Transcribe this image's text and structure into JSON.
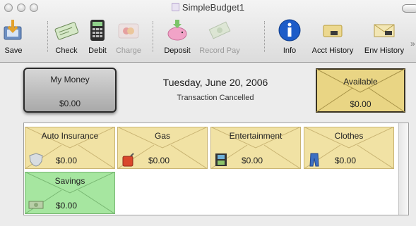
{
  "window": {
    "title": "SimpleBudget1"
  },
  "toolbar": [
    {
      "label": "Save",
      "icon": "save-icon",
      "enabled": true
    },
    {
      "label": "Check",
      "icon": "check-icon",
      "enabled": true
    },
    {
      "label": "Debit",
      "icon": "debit-icon",
      "enabled": true
    },
    {
      "label": "Charge",
      "icon": "charge-icon",
      "enabled": false
    },
    {
      "label": "Deposit",
      "icon": "deposit-icon",
      "enabled": true
    },
    {
      "label": "Record Pay",
      "icon": "record-pay-icon",
      "enabled": false
    },
    {
      "label": "Info",
      "icon": "info-icon",
      "enabled": true
    },
    {
      "label": "Acct History",
      "icon": "acct-history-icon",
      "enabled": true
    },
    {
      "label": "Env History",
      "icon": "env-history-icon",
      "enabled": true
    }
  ],
  "overflow": "»",
  "my_money": {
    "label": "My Money",
    "amount": "$0.00"
  },
  "date": "Tuesday, June 20, 2006",
  "status": "Transaction Cancelled",
  "available": {
    "label": "Available",
    "amount": "$0.00"
  },
  "envelopes": [
    {
      "name": "Auto Insurance",
      "amount": "$0.00",
      "icon": "shield-icon",
      "color": "#f1e2a4"
    },
    {
      "name": "Gas",
      "amount": "$0.00",
      "icon": "gas-can-icon",
      "color": "#f1e2a4"
    },
    {
      "name": "Entertainment",
      "amount": "$0.00",
      "icon": "film-icon",
      "color": "#f1e2a4"
    },
    {
      "name": "Clothes",
      "amount": "$0.00",
      "icon": "jeans-icon",
      "color": "#f1e2a4"
    },
    {
      "name": "Savings",
      "amount": "$0.00",
      "icon": "money-icon",
      "color": "#a6e6a0"
    }
  ]
}
